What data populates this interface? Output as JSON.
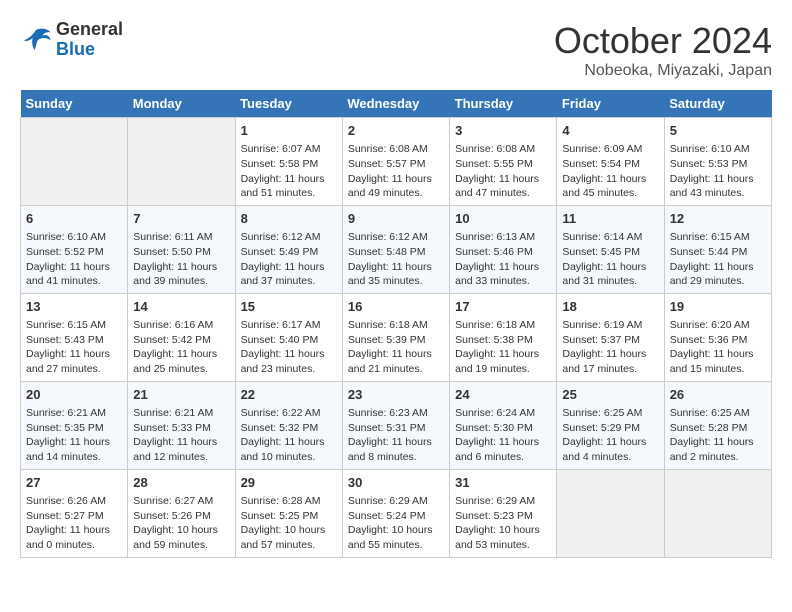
{
  "logo": {
    "line1": "General",
    "line2": "Blue"
  },
  "header": {
    "month": "October 2024",
    "location": "Nobeoka, Miyazaki, Japan"
  },
  "days_of_week": [
    "Sunday",
    "Monday",
    "Tuesday",
    "Wednesday",
    "Thursday",
    "Friday",
    "Saturday"
  ],
  "weeks": [
    [
      {
        "num": "",
        "empty": true
      },
      {
        "num": "",
        "empty": true
      },
      {
        "num": "1",
        "sunrise": "6:07 AM",
        "sunset": "5:58 PM",
        "daylight": "11 hours and 51 minutes."
      },
      {
        "num": "2",
        "sunrise": "6:08 AM",
        "sunset": "5:57 PM",
        "daylight": "11 hours and 49 minutes."
      },
      {
        "num": "3",
        "sunrise": "6:08 AM",
        "sunset": "5:55 PM",
        "daylight": "11 hours and 47 minutes."
      },
      {
        "num": "4",
        "sunrise": "6:09 AM",
        "sunset": "5:54 PM",
        "daylight": "11 hours and 45 minutes."
      },
      {
        "num": "5",
        "sunrise": "6:10 AM",
        "sunset": "5:53 PM",
        "daylight": "11 hours and 43 minutes."
      }
    ],
    [
      {
        "num": "6",
        "sunrise": "6:10 AM",
        "sunset": "5:52 PM",
        "daylight": "11 hours and 41 minutes."
      },
      {
        "num": "7",
        "sunrise": "6:11 AM",
        "sunset": "5:50 PM",
        "daylight": "11 hours and 39 minutes."
      },
      {
        "num": "8",
        "sunrise": "6:12 AM",
        "sunset": "5:49 PM",
        "daylight": "11 hours and 37 minutes."
      },
      {
        "num": "9",
        "sunrise": "6:12 AM",
        "sunset": "5:48 PM",
        "daylight": "11 hours and 35 minutes."
      },
      {
        "num": "10",
        "sunrise": "6:13 AM",
        "sunset": "5:46 PM",
        "daylight": "11 hours and 33 minutes."
      },
      {
        "num": "11",
        "sunrise": "6:14 AM",
        "sunset": "5:45 PM",
        "daylight": "11 hours and 31 minutes."
      },
      {
        "num": "12",
        "sunrise": "6:15 AM",
        "sunset": "5:44 PM",
        "daylight": "11 hours and 29 minutes."
      }
    ],
    [
      {
        "num": "13",
        "sunrise": "6:15 AM",
        "sunset": "5:43 PM",
        "daylight": "11 hours and 27 minutes."
      },
      {
        "num": "14",
        "sunrise": "6:16 AM",
        "sunset": "5:42 PM",
        "daylight": "11 hours and 25 minutes."
      },
      {
        "num": "15",
        "sunrise": "6:17 AM",
        "sunset": "5:40 PM",
        "daylight": "11 hours and 23 minutes."
      },
      {
        "num": "16",
        "sunrise": "6:18 AM",
        "sunset": "5:39 PM",
        "daylight": "11 hours and 21 minutes."
      },
      {
        "num": "17",
        "sunrise": "6:18 AM",
        "sunset": "5:38 PM",
        "daylight": "11 hours and 19 minutes."
      },
      {
        "num": "18",
        "sunrise": "6:19 AM",
        "sunset": "5:37 PM",
        "daylight": "11 hours and 17 minutes."
      },
      {
        "num": "19",
        "sunrise": "6:20 AM",
        "sunset": "5:36 PM",
        "daylight": "11 hours and 15 minutes."
      }
    ],
    [
      {
        "num": "20",
        "sunrise": "6:21 AM",
        "sunset": "5:35 PM",
        "daylight": "11 hours and 14 minutes."
      },
      {
        "num": "21",
        "sunrise": "6:21 AM",
        "sunset": "5:33 PM",
        "daylight": "11 hours and 12 minutes."
      },
      {
        "num": "22",
        "sunrise": "6:22 AM",
        "sunset": "5:32 PM",
        "daylight": "11 hours and 10 minutes."
      },
      {
        "num": "23",
        "sunrise": "6:23 AM",
        "sunset": "5:31 PM",
        "daylight": "11 hours and 8 minutes."
      },
      {
        "num": "24",
        "sunrise": "6:24 AM",
        "sunset": "5:30 PM",
        "daylight": "11 hours and 6 minutes."
      },
      {
        "num": "25",
        "sunrise": "6:25 AM",
        "sunset": "5:29 PM",
        "daylight": "11 hours and 4 minutes."
      },
      {
        "num": "26",
        "sunrise": "6:25 AM",
        "sunset": "5:28 PM",
        "daylight": "11 hours and 2 minutes."
      }
    ],
    [
      {
        "num": "27",
        "sunrise": "6:26 AM",
        "sunset": "5:27 PM",
        "daylight": "11 hours and 0 minutes."
      },
      {
        "num": "28",
        "sunrise": "6:27 AM",
        "sunset": "5:26 PM",
        "daylight": "10 hours and 59 minutes."
      },
      {
        "num": "29",
        "sunrise": "6:28 AM",
        "sunset": "5:25 PM",
        "daylight": "10 hours and 57 minutes."
      },
      {
        "num": "30",
        "sunrise": "6:29 AM",
        "sunset": "5:24 PM",
        "daylight": "10 hours and 55 minutes."
      },
      {
        "num": "31",
        "sunrise": "6:29 AM",
        "sunset": "5:23 PM",
        "daylight": "10 hours and 53 minutes."
      },
      {
        "num": "",
        "empty": true
      },
      {
        "num": "",
        "empty": true
      }
    ]
  ],
  "labels": {
    "sunrise": "Sunrise:",
    "sunset": "Sunset:",
    "daylight": "Daylight:"
  }
}
